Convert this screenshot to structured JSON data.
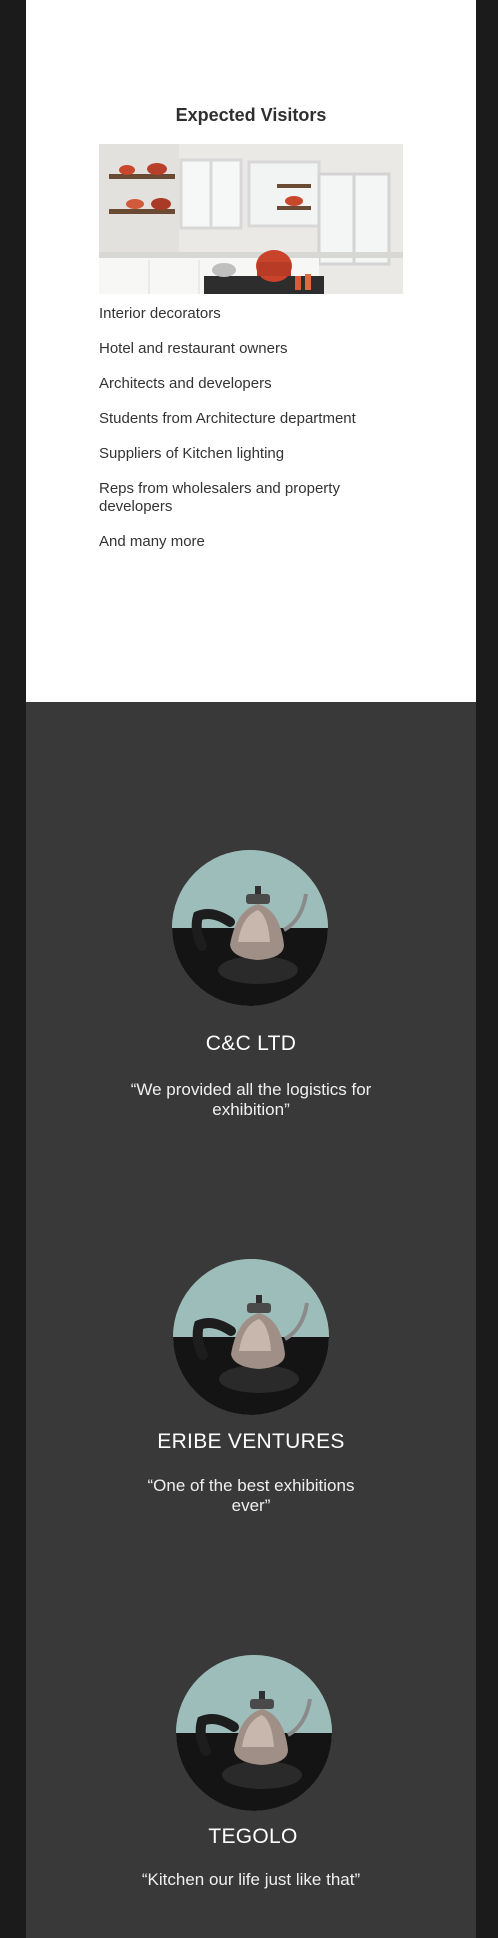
{
  "visitors": {
    "title": "Expected Visitors",
    "items": [
      "Interior decorators",
      "Hotel and restaurant owners",
      "Architects and developers",
      "Students from Architecture department",
      "Suppliers of Kitchen lighting",
      "Reps from wholesalers and property developers",
      "And many more"
    ]
  },
  "testimonials": [
    {
      "name": "C&C LTD",
      "quote": "“We provided all the logistics for exhibition”"
    },
    {
      "name": "ERIBE VENTURES",
      "quote": "“One of the best exhibitions ever”"
    },
    {
      "name": "TEGOLO",
      "quote": "“Kitchen our life just like that”"
    }
  ],
  "colors": {
    "outer_background": "#1b1b1b",
    "content_background": "#ffffff",
    "testimonial_background": "#393939"
  }
}
